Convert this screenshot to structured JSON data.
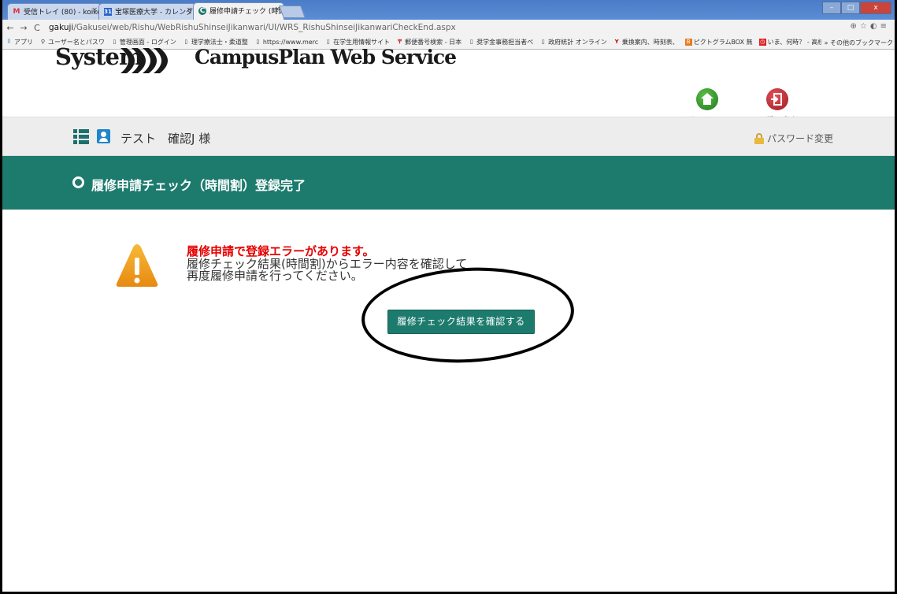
{
  "browser": {
    "tabs": [
      {
        "label": "受信トレイ (80) - koike",
        "favicon": "M"
      },
      {
        "label": "宝塚医療大学 - カレンダ",
        "favicon": "31"
      },
      {
        "label": "履修申請チェック (時間",
        "favicon": "C",
        "active": true
      }
    ],
    "url_host": "gakuji",
    "url_path": "/Gakusei/web/Rishu/WebRishuShinseiJikanwari/UI/WRS_RishuShinseiJikanwariCheckEnd.aspx",
    "bookmarks": [
      {
        "icon": "apps-icon",
        "label": "アプリ"
      },
      {
        "icon": "group-icon",
        "label": "ユーザー名とパスワ"
      },
      {
        "icon": "page-icon",
        "label": "管理画面 - ログイン"
      },
      {
        "icon": "page-icon",
        "label": "理学療法士・柔道整"
      },
      {
        "icon": "page-icon",
        "label": "https://www.merc"
      },
      {
        "icon": "page-icon",
        "label": "在学生用情報サイト"
      },
      {
        "icon": "post-icon",
        "label": "郵便番号検索 - 日本"
      },
      {
        "icon": "page-icon",
        "label": "奨学金事務担当者ペ"
      },
      {
        "icon": "page-icon",
        "label": "政府統計 オンライン"
      },
      {
        "icon": "yahoo-icon",
        "label": "乗換案内、時刻表、"
      },
      {
        "icon": "box-icon",
        "label": "ピクトグラムBOX 無"
      },
      {
        "icon": "red-icon",
        "label": "いま、何時？ - 高校"
      }
    ],
    "bookmarks_more": "» その他のブックマーク"
  },
  "header": {
    "logo_text": "System",
    "service_name": "CampusPlan Web Service",
    "main_menu_label": "メインメニュー",
    "logout_label": "ログアウト",
    "colors": {
      "home": "#2e8b2e",
      "logout": "#c0262d"
    }
  },
  "userbar": {
    "user_name": "テスト　確認J 様",
    "password_change": "パスワード変更"
  },
  "page": {
    "title": "履修申請チェック（時間割）登録完了",
    "accent": "#1d7b6e"
  },
  "message": {
    "error_line": "履修申請で登録エラーがあります。",
    "line2": "履修チェック結果(時間割)からエラー内容を確認して",
    "line3": "再度履修申請を行ってください。"
  },
  "actions": {
    "check_result_button": "履修チェック結果を確認する"
  }
}
